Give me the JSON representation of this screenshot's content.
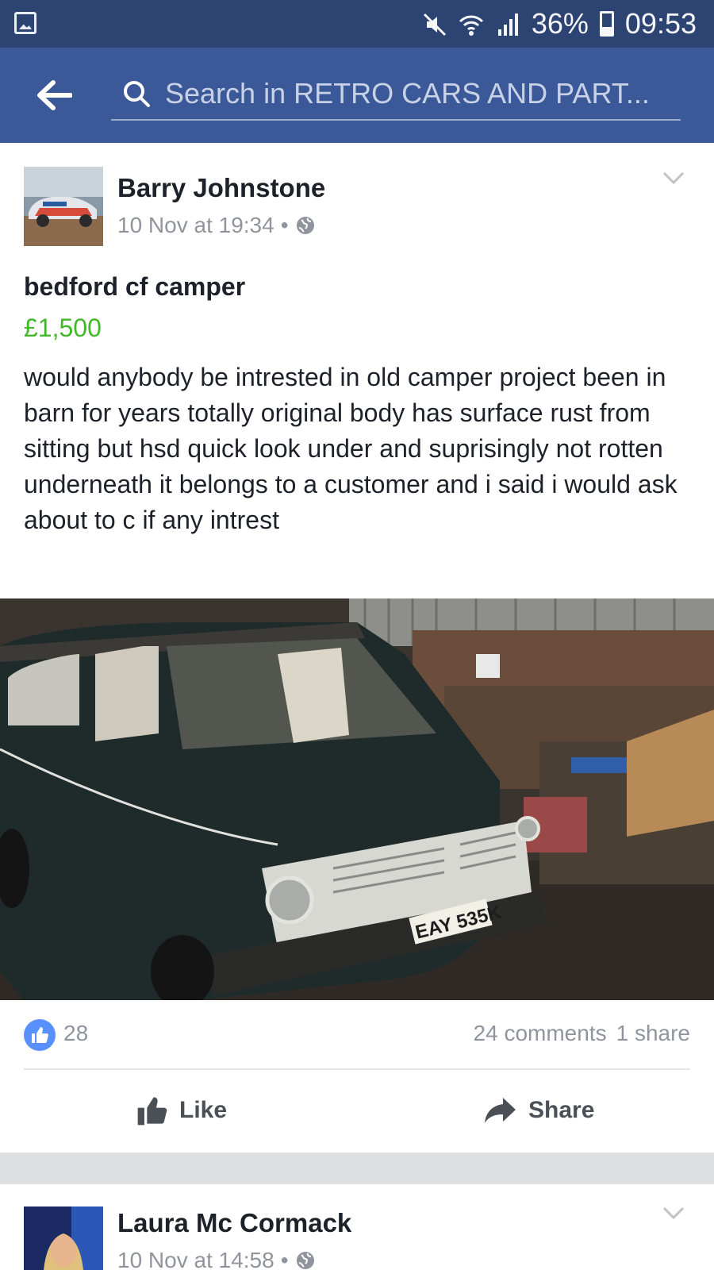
{
  "status_bar": {
    "battery_percent": "36%",
    "time": "09:53",
    "icons": [
      "gallery-icon",
      "mute-icon",
      "wifi-icon",
      "signal-icon",
      "battery-icon"
    ]
  },
  "header": {
    "search_placeholder": "Search in RETRO CARS AND PART..."
  },
  "post": {
    "author": "Barry Johnstone",
    "timestamp": "10 Nov at 19:34",
    "separator": "•",
    "title": "bedford cf camper",
    "price": "£1,500",
    "body": "would anybody be intrested in old camper project been in barn for years totally original body has surface rust from sitting but hsd quick look under and suprisingly not rotten underneath it belongs to a customer and i said i would ask about to c if any intrest",
    "photo_plate": "EAY 535K",
    "like_count": "28",
    "comments": "24 comments",
    "shares": "1 share",
    "like_label": "Like",
    "share_label": "Share"
  },
  "next_post": {
    "author": "Laura Mc Cormack",
    "timestamp": "10 Nov at 14:58",
    "separator": "•"
  },
  "colors": {
    "status_bar": "#2d4372",
    "app_bar": "#3b5998",
    "price": "#42b72a",
    "like_blue": "#5890ff",
    "muted_text": "#90949c"
  }
}
